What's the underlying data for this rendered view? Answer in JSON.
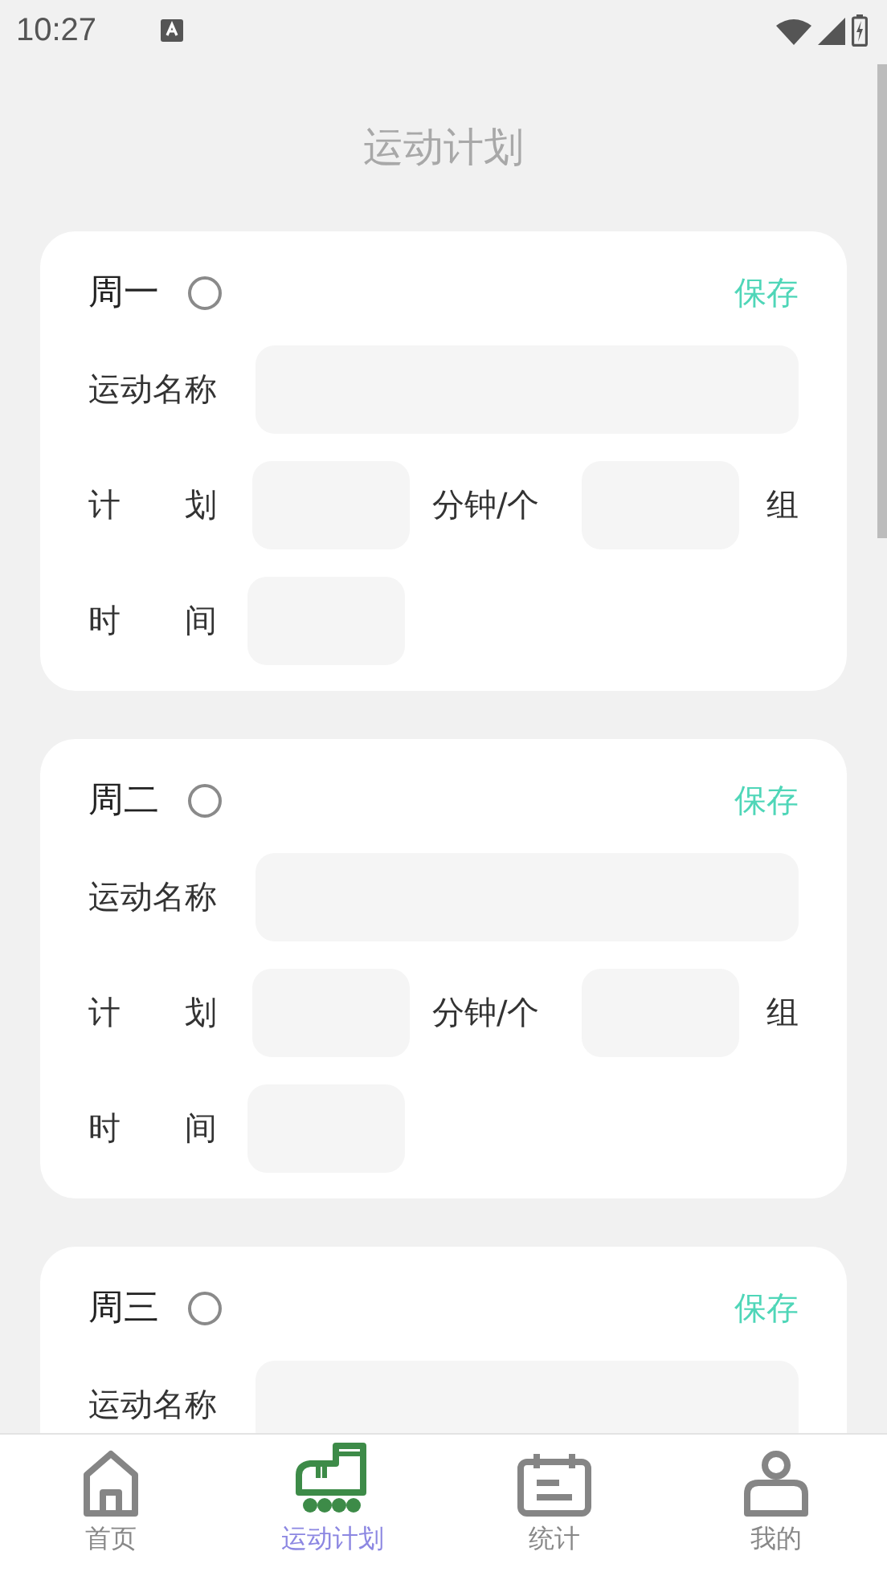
{
  "status_bar": {
    "time": "10:27"
  },
  "title": "运动计划",
  "cards": [
    {
      "day": "周一",
      "checked": false,
      "save": "保存",
      "rows": [
        {
          "kind": "name",
          "label": "运动名称"
        },
        {
          "kind": "plan",
          "label": "计 划",
          "unit1": "分钟/个",
          "unit2": "组"
        },
        {
          "kind": "time",
          "label": "时 间"
        }
      ]
    },
    {
      "day": "周二",
      "checked": false,
      "save": "保存",
      "rows": [
        {
          "kind": "name",
          "label": "运动名称"
        },
        {
          "kind": "plan",
          "label": "计 划",
          "unit1": "分钟/个",
          "unit2": "组"
        },
        {
          "kind": "time",
          "label": "时 间"
        }
      ]
    },
    {
      "day": "周三",
      "checked": false,
      "save": "保存",
      "rows": [
        {
          "kind": "name",
          "label": "运动名称"
        }
      ]
    }
  ],
  "nav": [
    {
      "label": "首页",
      "selected": false
    },
    {
      "label": "运动计划",
      "selected": true
    },
    {
      "label": "统计",
      "selected": false
    },
    {
      "label": "我的",
      "selected": false
    }
  ]
}
